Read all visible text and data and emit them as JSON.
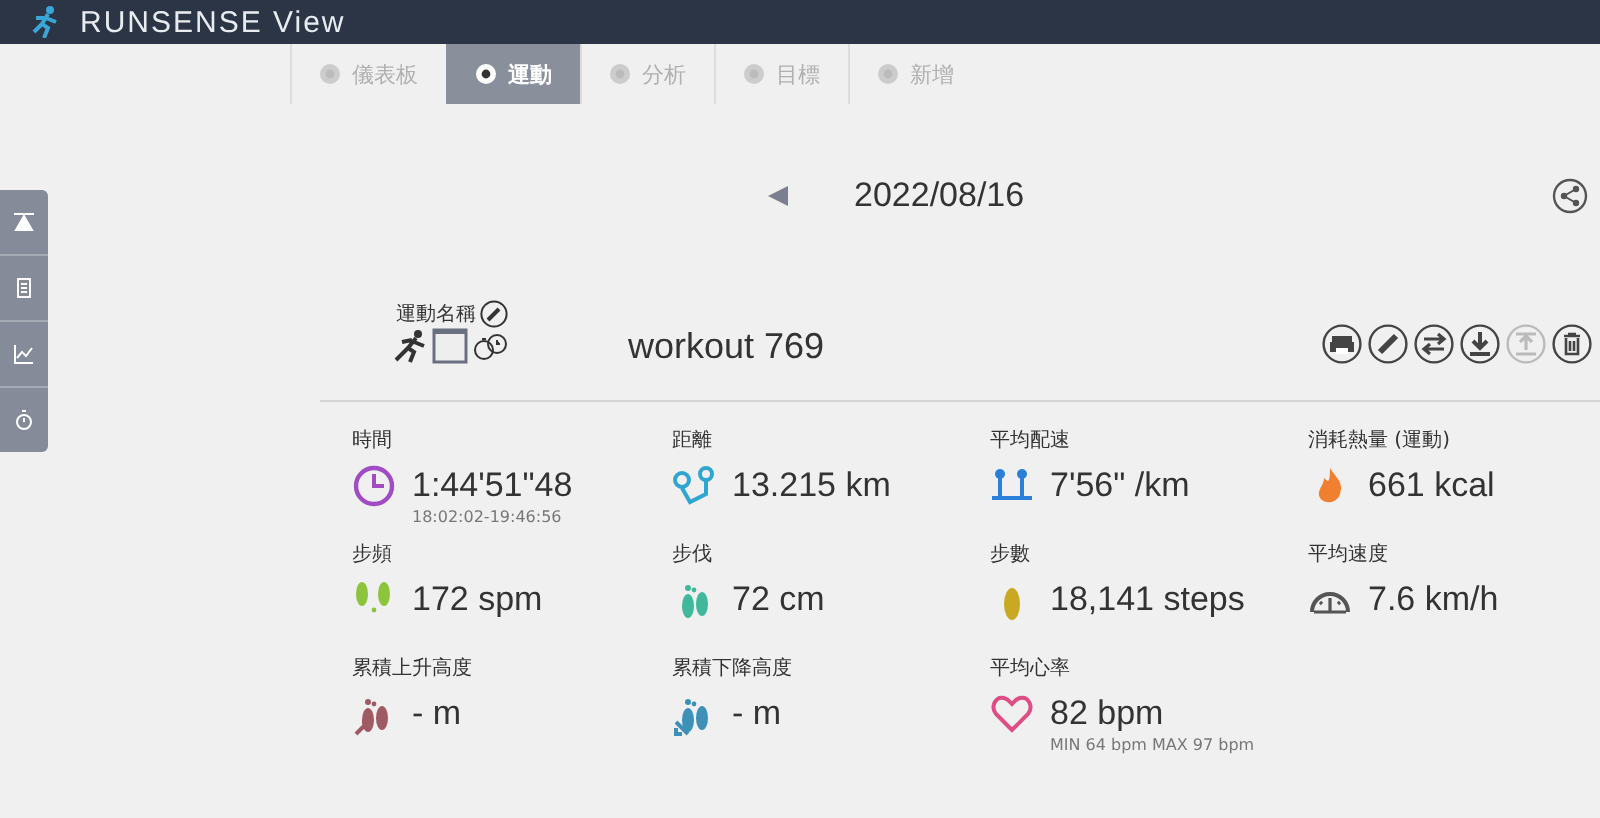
{
  "header": {
    "title": "RUNSENSE View"
  },
  "tabs": [
    {
      "label": "儀表板",
      "selected": false
    },
    {
      "label": "運動",
      "selected": true
    },
    {
      "label": "分析",
      "selected": false
    },
    {
      "label": "目標",
      "selected": false
    },
    {
      "label": "新增",
      "selected": false
    }
  ],
  "date": "2022/08/16",
  "workout": {
    "name_label": "運動名稱",
    "name": "workout 769"
  },
  "actions": [
    {
      "kind": "print",
      "disabled": false
    },
    {
      "kind": "edit",
      "disabled": false
    },
    {
      "kind": "swap",
      "disabled": false
    },
    {
      "kind": "download",
      "disabled": false
    },
    {
      "kind": "upload",
      "disabled": true
    },
    {
      "kind": "delete",
      "disabled": false
    }
  ],
  "stats": [
    {
      "kind": "time",
      "label": "時間",
      "value": "1:44'51\"48",
      "sub": "18:02:02-19:46:56"
    },
    {
      "kind": "distance",
      "label": "距離",
      "value": "13.215 km"
    },
    {
      "kind": "pace",
      "label": "平均配速",
      "value": "7'56\" /km"
    },
    {
      "kind": "calories",
      "label": "消耗熱量 (運動)",
      "value": "661 kcal"
    },
    {
      "kind": "cadence",
      "label": "步頻",
      "value": "172 spm"
    },
    {
      "kind": "stride",
      "label": "步伐",
      "value": "72 cm"
    },
    {
      "kind": "steps",
      "label": "步數",
      "value": "18,141 steps"
    },
    {
      "kind": "speed",
      "label": "平均速度",
      "value": "7.6 km/h"
    },
    {
      "kind": "ascent",
      "label": "累積上升高度",
      "value": "- m"
    },
    {
      "kind": "descent",
      "label": "累積下降高度",
      "value": "- m"
    },
    {
      "kind": "heart",
      "label": "平均心率",
      "value": "82 bpm",
      "sub": "MIN 64 bpm MAX 97 bpm"
    }
  ]
}
